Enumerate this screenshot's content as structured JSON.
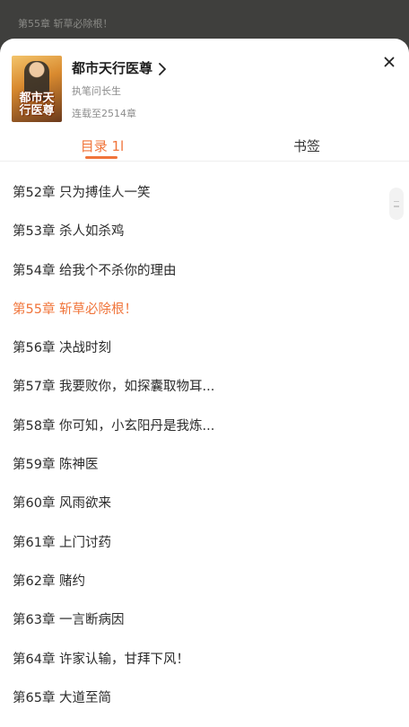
{
  "reader": {
    "current_line": "第55章 斩草必除根！"
  },
  "book": {
    "cover_text": "都市天行医尊",
    "title": "都市天行医尊",
    "author": "执笔问长生",
    "status": "连载至2514章"
  },
  "icons": {
    "chevron": "chevron-right-icon",
    "close": "close-icon"
  },
  "tabs": [
    {
      "label": "目录 1l",
      "active": true
    },
    {
      "label": "书签",
      "active": false
    }
  ],
  "colors": {
    "accent": "#f0743a",
    "text": "#2b2b2b",
    "muted": "#8c8c8c"
  },
  "chapters": [
    {
      "label": "第52章 只为搏佳人一笑"
    },
    {
      "label": "第53章 杀人如杀鸡"
    },
    {
      "label": "第54章 给我个不杀你的理由"
    },
    {
      "label": "第55章 斩草必除根！",
      "current": true
    },
    {
      "label": "第56章 决战时刻"
    },
    {
      "label": "第57章 我要败你，如探囊取物耳..."
    },
    {
      "label": "第58章 你可知，小玄阳丹是我炼..."
    },
    {
      "label": "第59章 陈神医"
    },
    {
      "label": "第60章 风雨欲来"
    },
    {
      "label": "第61章 上门讨药"
    },
    {
      "label": "第62章 赌约"
    },
    {
      "label": "第63章 一言断病因"
    },
    {
      "label": "第64章 许家认输，甘拜下风！"
    },
    {
      "label": "第65章 大道至简"
    }
  ]
}
